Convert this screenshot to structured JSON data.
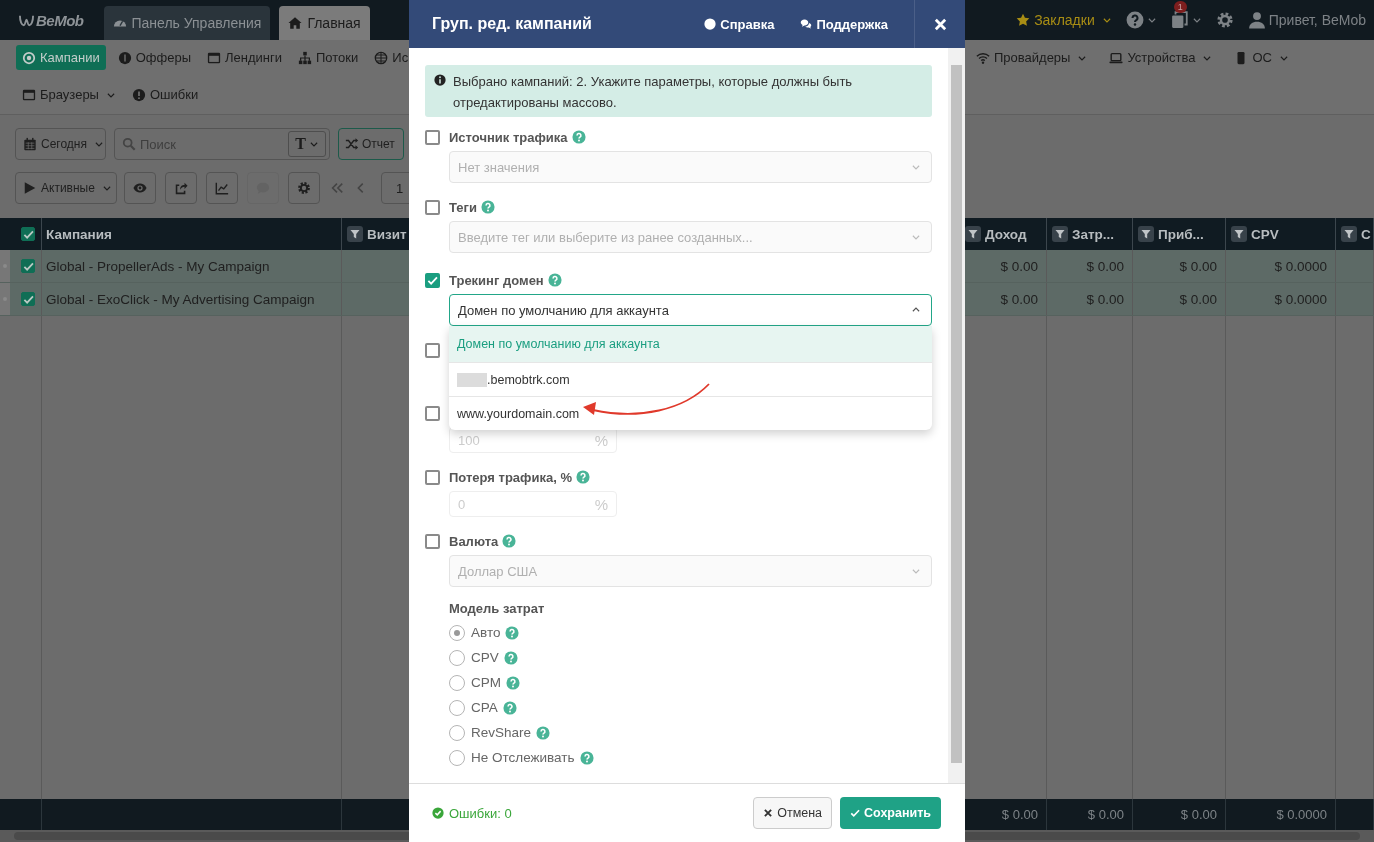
{
  "topbar": {
    "logo": "BeMob",
    "tabs": [
      {
        "label": "Панель Управления",
        "selected": false
      },
      {
        "label": "Главная",
        "selected": true
      }
    ],
    "bookmarks": "Закладки",
    "notification_count": "1",
    "greeting": "Привет, BeMob"
  },
  "nav": {
    "row1_left": [
      {
        "label": "Кампании",
        "selected": true,
        "dropdown": false
      },
      {
        "label": "Офферы",
        "selected": false,
        "dropdown": false
      },
      {
        "label": "Лендинги",
        "selected": false,
        "dropdown": false
      },
      {
        "label": "Потоки",
        "selected": false,
        "dropdown": false
      },
      {
        "label": "Ис",
        "selected": false,
        "dropdown": false
      }
    ],
    "row1_right": [
      {
        "label": "Провайдеры",
        "selected": false,
        "dropdown": true
      },
      {
        "label": "Устройства",
        "selected": false,
        "dropdown": true
      },
      {
        "label": "ОС",
        "selected": false,
        "dropdown": true
      }
    ],
    "row2": [
      {
        "label": "Браузеры",
        "selected": false,
        "dropdown": true
      },
      {
        "label": "Ошибки",
        "selected": false,
        "dropdown": false
      }
    ]
  },
  "toolbar": {
    "date_range": "Сегодня",
    "search": {
      "placeholder": "Поиск",
      "type_label": "T"
    },
    "report": "Отчет",
    "status_filter": "Активные",
    "page": "1"
  },
  "table": {
    "all_checked": true,
    "columns_left": [
      "Кампания",
      "Визит"
    ],
    "columns_right": [
      "Доход",
      "Затр...",
      "Приб...",
      "CPV",
      "C"
    ],
    "rows": [
      {
        "checked": true,
        "name": "Global - PropellerAds - My Campaign",
        "values": [
          "$ 0.00",
          "$ 0.00",
          "$ 0.00",
          "$ 0.0000"
        ]
      },
      {
        "checked": true,
        "name": "Global - ExoClick - My Advertising Campaign",
        "values": [
          "$ 0.00",
          "$ 0.00",
          "$ 0.00",
          "$ 0.0000"
        ]
      }
    ],
    "totals": [
      "$ 0.00",
      "$ 0.00",
      "$ 0.00",
      "$ 0.0000"
    ]
  },
  "modal": {
    "title": "Груп. ред. кампаний",
    "help": "Справка",
    "support": "Поддержка",
    "notice": "Выбрано кампаний: 2. Укажите параметры, которые должны быть отредактированы массово.",
    "fields": [
      {
        "checked": false,
        "label": "Источник трафика",
        "control": {
          "kind": "select",
          "value": "Нет значения",
          "open": false
        }
      },
      {
        "checked": false,
        "label": "Теги",
        "control": {
          "kind": "select",
          "placeholder": "Введите тег или выберите из ранее созданных...",
          "open": false
        }
      },
      {
        "checked": true,
        "label": "Трекинг домен",
        "control": {
          "kind": "select",
          "value": "Домен по умолчанию для аккаунта",
          "open": true
        }
      },
      {
        "checked": false
      },
      {
        "checked": false,
        "control": {
          "kind": "percent",
          "value": "100",
          "unit": "%"
        }
      },
      {
        "checked": false,
        "label": "Потеря трафика, %",
        "control": {
          "kind": "percent",
          "value": "0",
          "unit": "%"
        }
      },
      {
        "checked": false,
        "label": "Валюта",
        "control": {
          "kind": "select",
          "value": "Доллар США",
          "open": false
        }
      }
    ],
    "domain_dropdown": {
      "options": [
        {
          "label": "Домен по умолчанию для аккаунта",
          "selected": true,
          "redacted_prefix": false
        },
        {
          "label": ".bemobtrk.com",
          "selected": false,
          "redacted_prefix": true
        },
        {
          "label": "www.yourdomain.com",
          "selected": false,
          "redacted_prefix": false
        }
      ]
    },
    "cost_model": {
      "label": "Модель затрат",
      "options": [
        {
          "label": "Авто",
          "selected": true
        },
        {
          "label": "CPV",
          "selected": false
        },
        {
          "label": "CPM",
          "selected": false
        },
        {
          "label": "CPA",
          "selected": false
        },
        {
          "label": "RevShare",
          "selected": false
        },
        {
          "label": "Не Отслеживать",
          "selected": false
        }
      ]
    },
    "errors": "Ошибки: 0",
    "cancel": "Отмена",
    "save": "Сохранить"
  }
}
